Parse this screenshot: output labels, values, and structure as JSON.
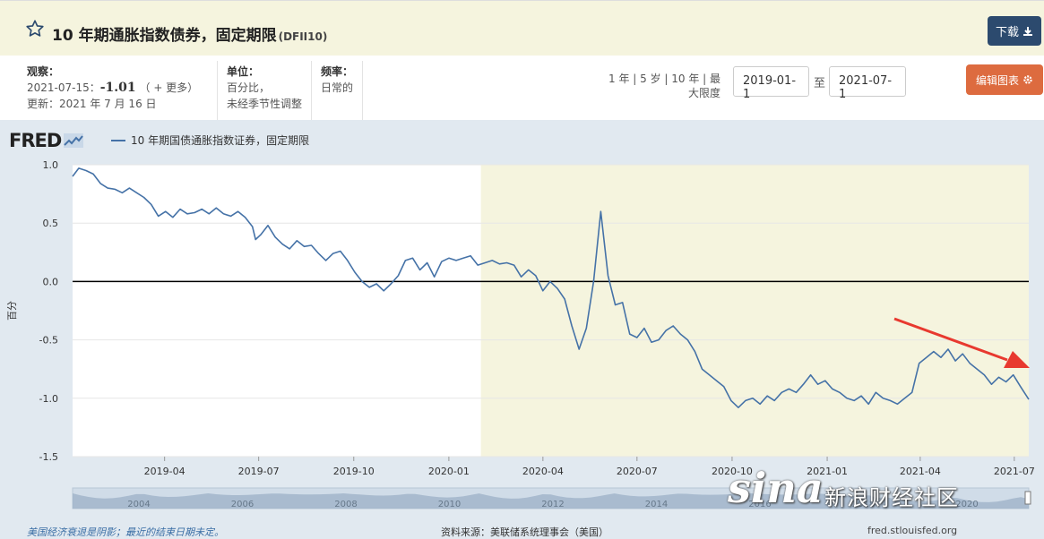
{
  "header": {
    "title": "10 年期通胀指数债券，固定期限",
    "series_id": "(DFII10)",
    "download_label": "下载"
  },
  "meta": {
    "obs_label": "观察：",
    "obs_date": "2021-07-15：",
    "obs_value": "-1.01",
    "obs_more": "（ + 更多）",
    "updated": "更新：2021 年 7 月 16 日",
    "units_label": "单位：",
    "units_line1": "百分比，",
    "units_line2": "未经季节性调整",
    "freq_label": "频率：",
    "freq_value": "日常的"
  },
  "controls": {
    "periods": "1 年 | 5 岁 | 10 年 | 最大限度",
    "start_date": "2019-01-1",
    "to_label": "至",
    "end_date": "2021-07-1",
    "edit_label": "编辑图表"
  },
  "logo": "FRED",
  "legend_label": "10 年期国债通胀指数证券，固定期限",
  "footnote": "美国经济衰退是阴影；最近的结束日期未定。",
  "source": "资料来源：美联储系统理事会（美国）",
  "url": "fred.stlouisfed.org",
  "watermark": {
    "brand": "sina",
    "text": "新浪财经社区"
  },
  "colors": {
    "series": "#4572a7",
    "recession": "#f5f4de",
    "arrow": "#e8392f",
    "accent": "#dd6b3f"
  },
  "icons": {
    "title": "star-icon",
    "download": "download-icon",
    "edit": "gear-icon"
  },
  "chart_data": {
    "type": "line",
    "ylabel": "百分",
    "ylim": [
      -1.5,
      1.0
    ],
    "yticks": [
      "1.0",
      "0.5",
      "0.0",
      "-0.5",
      "-1.0",
      "-1.5"
    ],
    "xlim": [
      "2019-01-02",
      "2021-07-15"
    ],
    "xticks": [
      "2019-04",
      "2019-07",
      "2019-10",
      "2020-01",
      "2020-04",
      "2020-07",
      "2020-10",
      "2021-01",
      "2021-04",
      "2021-07"
    ],
    "recession": [
      "2020-02-01",
      "2021-07-15"
    ],
    "series": [
      {
        "values": [
          [
            "2019-01-02",
            0.9
          ],
          [
            "2019-01-08",
            0.97
          ],
          [
            "2019-01-15",
            0.95
          ],
          [
            "2019-01-22",
            0.92
          ],
          [
            "2019-01-29",
            0.84
          ],
          [
            "2019-02-05",
            0.8
          ],
          [
            "2019-02-12",
            0.79
          ],
          [
            "2019-02-19",
            0.76
          ],
          [
            "2019-02-26",
            0.8
          ],
          [
            "2019-03-05",
            0.76
          ],
          [
            "2019-03-12",
            0.72
          ],
          [
            "2019-03-19",
            0.66
          ],
          [
            "2019-03-26",
            0.56
          ],
          [
            "2019-04-02",
            0.6
          ],
          [
            "2019-04-09",
            0.55
          ],
          [
            "2019-04-16",
            0.62
          ],
          [
            "2019-04-23",
            0.58
          ],
          [
            "2019-04-30",
            0.59
          ],
          [
            "2019-05-07",
            0.62
          ],
          [
            "2019-05-14",
            0.58
          ],
          [
            "2019-05-21",
            0.63
          ],
          [
            "2019-05-28",
            0.58
          ],
          [
            "2019-06-04",
            0.56
          ],
          [
            "2019-06-11",
            0.6
          ],
          [
            "2019-06-18",
            0.55
          ],
          [
            "2019-06-25",
            0.47
          ],
          [
            "2019-06-28",
            0.36
          ],
          [
            "2019-07-03",
            0.4
          ],
          [
            "2019-07-10",
            0.48
          ],
          [
            "2019-07-17",
            0.38
          ],
          [
            "2019-07-24",
            0.32
          ],
          [
            "2019-07-31",
            0.28
          ],
          [
            "2019-08-07",
            0.35
          ],
          [
            "2019-08-14",
            0.3
          ],
          [
            "2019-08-21",
            0.31
          ],
          [
            "2019-08-28",
            0.24
          ],
          [
            "2019-09-04",
            0.18
          ],
          [
            "2019-09-11",
            0.24
          ],
          [
            "2019-09-18",
            0.26
          ],
          [
            "2019-09-25",
            0.18
          ],
          [
            "2019-10-02",
            0.08
          ],
          [
            "2019-10-09",
            0.0
          ],
          [
            "2019-10-16",
            -0.05
          ],
          [
            "2019-10-23",
            -0.02
          ],
          [
            "2019-10-30",
            -0.08
          ],
          [
            "2019-11-06",
            -0.02
          ],
          [
            "2019-11-13",
            0.05
          ],
          [
            "2019-11-20",
            0.18
          ],
          [
            "2019-11-27",
            0.2
          ],
          [
            "2019-12-04",
            0.1
          ],
          [
            "2019-12-11",
            0.16
          ],
          [
            "2019-12-18",
            0.04
          ],
          [
            "2019-12-25",
            0.17
          ],
          [
            "2020-01-01",
            0.2
          ],
          [
            "2020-01-08",
            0.18
          ],
          [
            "2020-01-15",
            0.2
          ],
          [
            "2020-01-22",
            0.22
          ],
          [
            "2020-01-29",
            0.14
          ],
          [
            "2020-02-05",
            0.16
          ],
          [
            "2020-02-12",
            0.18
          ],
          [
            "2020-02-19",
            0.15
          ],
          [
            "2020-02-26",
            0.16
          ],
          [
            "2020-03-04",
            0.14
          ],
          [
            "2020-03-11",
            0.04
          ],
          [
            "2020-03-18",
            0.1
          ],
          [
            "2020-03-25",
            0.05
          ],
          [
            "2020-04-01",
            -0.08
          ],
          [
            "2020-04-08",
            0.0
          ],
          [
            "2020-04-15",
            -0.06
          ],
          [
            "2020-04-22",
            -0.15
          ],
          [
            "2020-04-29",
            -0.38
          ],
          [
            "2020-05-06",
            -0.58
          ],
          [
            "2020-05-13",
            -0.4
          ],
          [
            "2020-05-20",
            0.0
          ],
          [
            "2020-05-27",
            0.6
          ],
          [
            "2020-06-03",
            0.05
          ],
          [
            "2020-06-10",
            -0.2
          ],
          [
            "2020-06-17",
            -0.18
          ],
          [
            "2020-06-24",
            -0.45
          ],
          [
            "2020-07-01",
            -0.48
          ],
          [
            "2020-07-08",
            -0.4
          ],
          [
            "2020-07-15",
            -0.52
          ],
          [
            "2020-07-22",
            -0.5
          ],
          [
            "2020-07-29",
            -0.42
          ],
          [
            "2020-08-05",
            -0.38
          ],
          [
            "2020-08-12",
            -0.45
          ],
          [
            "2020-08-19",
            -0.5
          ],
          [
            "2020-08-26",
            -0.6
          ],
          [
            "2020-09-02",
            -0.75
          ],
          [
            "2020-09-09",
            -0.8
          ],
          [
            "2020-09-16",
            -0.85
          ],
          [
            "2020-09-23",
            -0.9
          ],
          [
            "2020-09-30",
            -1.02
          ],
          [
            "2020-10-07",
            -1.08
          ],
          [
            "2020-10-14",
            -1.02
          ],
          [
            "2020-10-21",
            -1.0
          ],
          [
            "2020-10-28",
            -1.05
          ],
          [
            "2020-11-04",
            -0.98
          ],
          [
            "2020-11-11",
            -1.02
          ],
          [
            "2020-11-18",
            -0.95
          ],
          [
            "2020-11-25",
            -0.92
          ],
          [
            "2020-12-02",
            -0.95
          ],
          [
            "2020-12-09",
            -0.88
          ],
          [
            "2020-12-16",
            -0.8
          ],
          [
            "2020-12-23",
            -0.88
          ],
          [
            "2020-12-30",
            -0.85
          ],
          [
            "2021-01-06",
            -0.92
          ],
          [
            "2021-01-13",
            -0.95
          ],
          [
            "2021-01-20",
            -1.0
          ],
          [
            "2021-01-27",
            -1.02
          ],
          [
            "2021-02-03",
            -0.98
          ],
          [
            "2021-02-10",
            -1.05
          ],
          [
            "2021-02-17",
            -0.95
          ],
          [
            "2021-02-24",
            -1.0
          ],
          [
            "2021-03-03",
            -1.02
          ],
          [
            "2021-03-10",
            -1.05
          ],
          [
            "2021-03-17",
            -1.0
          ],
          [
            "2021-03-24",
            -0.95
          ],
          [
            "2021-03-31",
            -0.7
          ],
          [
            "2021-04-07",
            -0.65
          ],
          [
            "2021-04-14",
            -0.6
          ],
          [
            "2021-04-21",
            -0.65
          ],
          [
            "2021-04-28",
            -0.58
          ],
          [
            "2021-05-05",
            -0.68
          ],
          [
            "2021-05-12",
            -0.62
          ],
          [
            "2021-05-19",
            -0.7
          ],
          [
            "2021-05-26",
            -0.75
          ],
          [
            "2021-06-02",
            -0.8
          ],
          [
            "2021-06-09",
            -0.88
          ],
          [
            "2021-06-16",
            -0.82
          ],
          [
            "2021-06-23",
            -0.86
          ],
          [
            "2021-06-30",
            -0.8
          ],
          [
            "2021-07-07",
            -0.9
          ],
          [
            "2021-07-15",
            -1.01
          ]
        ]
      }
    ]
  },
  "navigator": {
    "labels": [
      "2004",
      "2006",
      "2008",
      "2010",
      "2012",
      "2014",
      "2016",
      "2018",
      "2020"
    ]
  }
}
